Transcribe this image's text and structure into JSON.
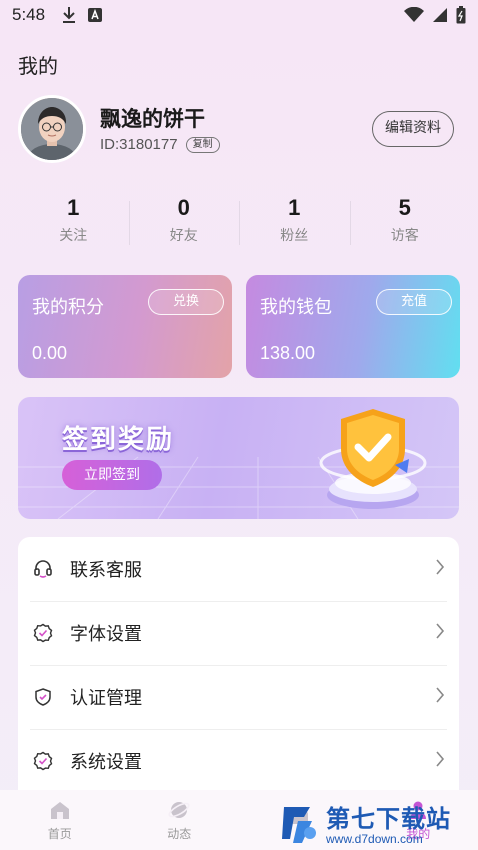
{
  "status_bar": {
    "time": "5:48"
  },
  "page": {
    "title": "我的"
  },
  "profile": {
    "username": "飘逸的饼干",
    "uid": "ID:3180177",
    "copy_label": "复制",
    "edit_label": "编辑资料"
  },
  "stats": [
    {
      "value": "1",
      "label": "关注"
    },
    {
      "value": "0",
      "label": "好友"
    },
    {
      "value": "1",
      "label": "粉丝"
    },
    {
      "value": "5",
      "label": "访客"
    }
  ],
  "cards": {
    "points": {
      "title": "我的积分",
      "value": "0.00",
      "button": "兑换"
    },
    "wallet": {
      "title": "我的钱包",
      "value": "138.00",
      "button": "充值"
    }
  },
  "banner": {
    "title": "签到奖励",
    "button": "立即签到"
  },
  "menu": [
    {
      "label": "联系客服",
      "icon": "headset-icon"
    },
    {
      "label": "字体设置",
      "icon": "badge-check-icon"
    },
    {
      "label": "认证管理",
      "icon": "shield-check-icon"
    },
    {
      "label": "系统设置",
      "icon": "gear-check-icon"
    }
  ],
  "bottom_nav": [
    {
      "label": "首页",
      "icon": "home-icon"
    },
    {
      "label": "动态",
      "icon": "planet-icon"
    },
    {
      "label": "",
      "icon": "message-icon"
    },
    {
      "label": "我的",
      "icon": "profile-icon"
    }
  ],
  "watermark": {
    "cn": "第七下载站",
    "url": "www.d7down.com"
  },
  "colors": {
    "accent": "#c455d4",
    "watermark_blue": "#1e5ab4"
  }
}
